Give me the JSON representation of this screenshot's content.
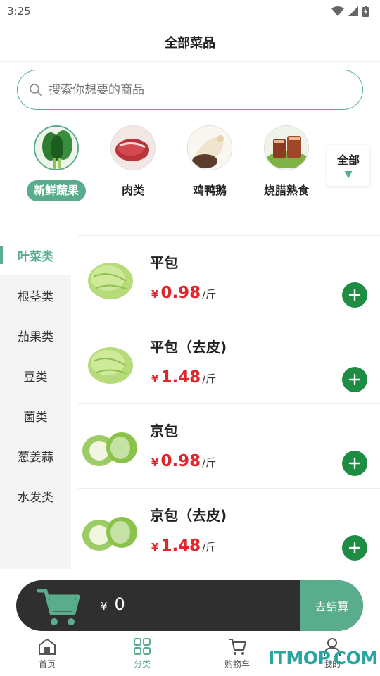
{
  "status_bar": {
    "time": "3:25"
  },
  "header": {
    "title": "全部菜品"
  },
  "search": {
    "placeholder": "搜索你想要的商品"
  },
  "categories": [
    {
      "label": "新鲜蔬果",
      "icon": "vegetable-thumbnail",
      "active": true
    },
    {
      "label": "肉类",
      "icon": "meat-thumbnail",
      "active": false
    },
    {
      "label": "鸡鸭鹅",
      "icon": "poultry-thumbnail",
      "active": false
    },
    {
      "label": "烧腊熟食",
      "icon": "roast-meat-thumbnail",
      "active": false
    }
  ],
  "categories_all": {
    "label": "全部",
    "arrow": "▼"
  },
  "sidebar": {
    "items": [
      {
        "label": "叶菜类",
        "active": true
      },
      {
        "label": "根茎类"
      },
      {
        "label": "茄果类"
      },
      {
        "label": "豆类"
      },
      {
        "label": "菌类"
      },
      {
        "label": "葱姜蒜"
      },
      {
        "label": "水发类"
      }
    ]
  },
  "products": [
    {
      "name": "平包",
      "currency": "¥",
      "price": "0.98",
      "unit": "/斤",
      "image": "cabbage-round-thumbnail"
    },
    {
      "name": "平包（去皮)",
      "currency": "¥",
      "price": "1.48",
      "unit": "/斤",
      "image": "cabbage-round-thumbnail"
    },
    {
      "name": "京包",
      "currency": "¥",
      "price": "0.98",
      "unit": "/斤",
      "image": "napa-cabbage-thumbnail"
    },
    {
      "name": "京包（去皮)",
      "currency": "¥",
      "price": "1.48",
      "unit": "/斤",
      "image": "napa-cabbage-thumbnail"
    }
  ],
  "cart": {
    "currency": "¥",
    "total": "0",
    "checkout_label": "去结算"
  },
  "bottom_nav": {
    "items": [
      {
        "label": "首页",
        "icon": "home-icon"
      },
      {
        "label": "分类",
        "icon": "category-grid-icon",
        "active": true
      },
      {
        "label": "购物车",
        "icon": "cart-icon"
      },
      {
        "label": "我的",
        "icon": "user-icon"
      }
    ]
  },
  "watermark": "ITMOP.COM",
  "colors": {
    "accent": "#5aad8c",
    "price": "#e0262a",
    "add_button": "#1e8c43",
    "cart_bar": "#2f2f2f"
  }
}
